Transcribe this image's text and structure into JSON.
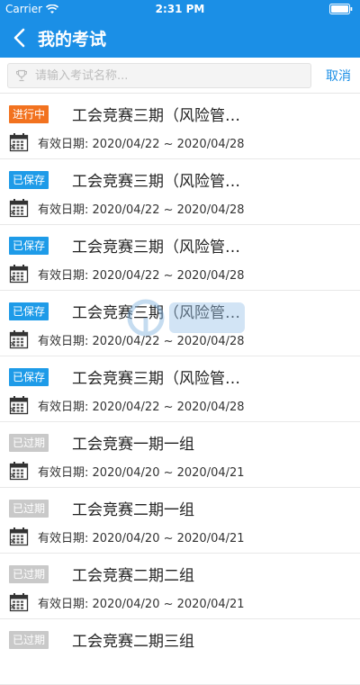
{
  "status_bar": {
    "carrier": "Carrier",
    "time": "2:31 PM"
  },
  "nav": {
    "title": "我的考试"
  },
  "search": {
    "placeholder": "请输入考试名称...",
    "cancel_label": "取消"
  },
  "colors": {
    "primary": "#1b8fe6",
    "in_progress": "#f2721f",
    "saved": "#1e9be8",
    "expired": "#c9c9c9"
  },
  "exams": [
    {
      "status": "进行中",
      "status_type": "in_progress",
      "title": "工会竞赛三期（风险管…",
      "date_label": "有效日期:",
      "date_range": "2020/04/22 ~ 2020/04/28"
    },
    {
      "status": "已保存",
      "status_type": "saved",
      "title": "工会竞赛三期（风险管…",
      "date_label": "有效日期:",
      "date_range": "2020/04/22 ~ 2020/04/28"
    },
    {
      "status": "已保存",
      "status_type": "saved",
      "title": "工会竞赛三期（风险管…",
      "date_label": "有效日期:",
      "date_range": "2020/04/22 ~ 2020/04/28"
    },
    {
      "status": "已保存",
      "status_type": "saved",
      "title": "工会竞赛三期（风险管…",
      "date_label": "有效日期:",
      "date_range": "2020/04/22 ~ 2020/04/28"
    },
    {
      "status": "已保存",
      "status_type": "saved",
      "title": "工会竞赛三期（风险管…",
      "date_label": "有效日期:",
      "date_range": "2020/04/22 ~ 2020/04/28"
    },
    {
      "status": "已过期",
      "status_type": "expired",
      "title": "工会竞赛一期一组",
      "date_label": "有效日期:",
      "date_range": "2020/04/20 ~ 2020/04/21"
    },
    {
      "status": "已过期",
      "status_type": "expired",
      "title": "工会竞赛二期一组",
      "date_label": "有效日期:",
      "date_range": "2020/04/20 ~ 2020/04/21"
    },
    {
      "status": "已过期",
      "status_type": "expired",
      "title": "工会竞赛二期二组",
      "date_label": "有效日期:",
      "date_range": "2020/04/20 ~ 2020/04/21"
    },
    {
      "status": "已过期",
      "status_type": "expired",
      "title": "工会竞赛二期三组",
      "date_label": "",
      "date_range": ""
    }
  ]
}
